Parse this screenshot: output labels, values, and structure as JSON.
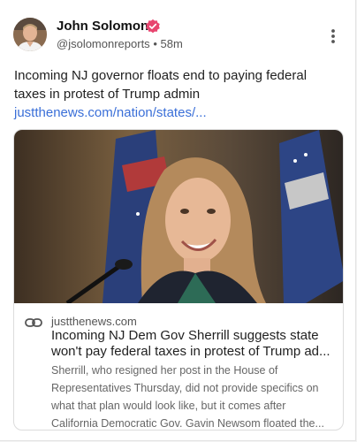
{
  "post": {
    "author_name": "John Solomon",
    "handle": "@jsolomonreports",
    "separator": "•",
    "time": "58m",
    "text": "Incoming NJ governor floats end to paying federal taxes in protest of Trump admin ",
    "link_text": "justthenews.com/nation/states/..."
  },
  "link_preview": {
    "domain": "justthenews.com",
    "title_line1": "Incoming NJ Dem Gov Sherrill suggests state",
    "title_line2": "won't pay federal taxes in protest of Trump ad...",
    "desc_line1": "Sherrill, who resigned her post in the House of",
    "desc_line2": "Representatives Thursday, did not provide specifics on",
    "desc_line3": "what that plan would look like, but it comes after",
    "desc_line4": "California Democratic Gov. Gavin Newsom floated the..."
  },
  "icons": {
    "verified": "verified-badge-icon",
    "more": "more-vertical-icon",
    "link": "link-chain-icon"
  },
  "colors": {
    "verified_badge": "#e8456f",
    "link": "#3a6fd8"
  }
}
